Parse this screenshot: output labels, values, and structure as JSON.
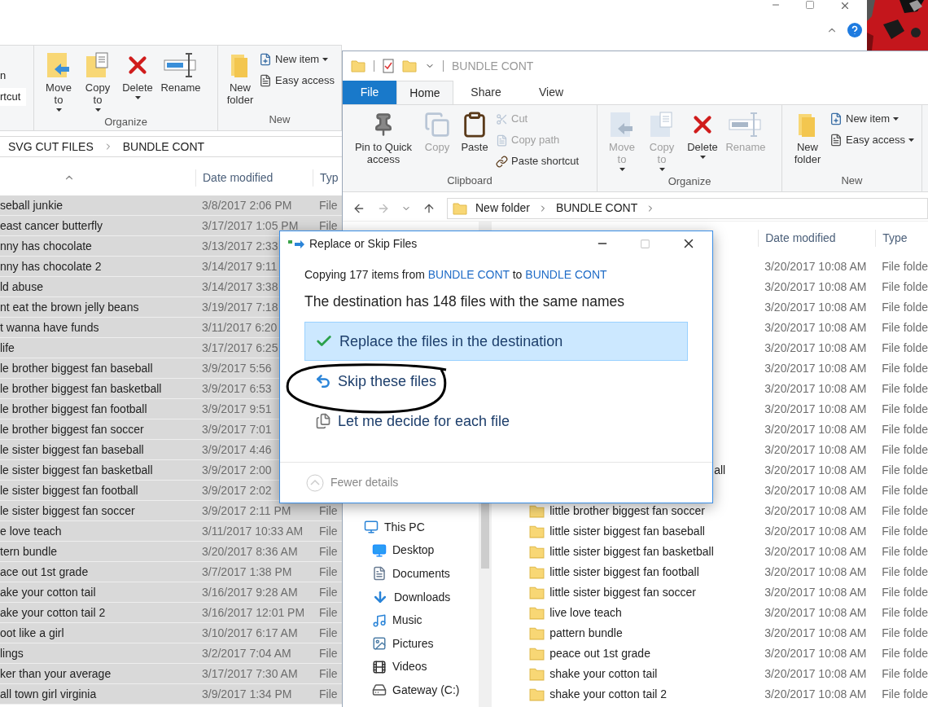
{
  "back_window": {
    "ribbon": {
      "fragment": [
        "n",
        "rtcut"
      ],
      "groups": [
        {
          "label": "Organize",
          "buttons": [
            {
              "kind": "move",
              "label": "Move\nto",
              "dropdown": true
            },
            {
              "kind": "copy",
              "label": "Copy\nto",
              "dropdown": true
            },
            {
              "kind": "delete",
              "label": "Delete",
              "dropdown": true
            },
            {
              "kind": "rename",
              "label": "Rename",
              "dropdown": false
            }
          ]
        },
        {
          "label": "New",
          "buttons": [
            {
              "kind": "folder",
              "label": "New\nfolder",
              "dropdown": false
            }
          ],
          "small": [
            {
              "kind": "newitem",
              "label": "New item",
              "dropdown": true
            },
            {
              "kind": "easy",
              "label": "Easy access"
            }
          ]
        }
      ]
    },
    "address": [
      "SVG CUT FILES",
      "BUNDLE CONT"
    ],
    "columns": [
      "Date modified",
      "Typ"
    ],
    "rows": [
      {
        "name": "seball junkie",
        "date": "3/8/2017 2:06 PM",
        "type": "File",
        "selected": true
      },
      {
        "name": "east cancer butterfly",
        "date": "3/17/2017 1:05 PM",
        "type": "File",
        "selected": true
      },
      {
        "name": "nny has chocolate",
        "date": "3/13/2017 2:33",
        "selected": true
      },
      {
        "name": "nny has chocolate 2",
        "date": "3/14/2017 9:11",
        "selected": true
      },
      {
        "name": "ld abuse",
        "date": "3/14/2017 3:38",
        "selected": true
      },
      {
        "name": "nt eat the brown jelly beans",
        "date": "3/19/2017 7:18",
        "selected": true
      },
      {
        "name": "t wanna have funds",
        "date": "3/11/2017 6:20",
        "selected": true
      },
      {
        "name": "life",
        "date": "3/17/2017 6:25",
        "selected": true
      },
      {
        "name": "le brother biggest fan baseball",
        "date": "3/9/2017 5:56",
        "selected": true
      },
      {
        "name": "le brother biggest fan basketball",
        "date": "3/9/2017 6:53",
        "selected": true
      },
      {
        "name": "le brother biggest fan football",
        "date": "3/9/2017 9:51",
        "selected": true
      },
      {
        "name": "le brother biggest fan soccer",
        "date": "3/9/2017 7:01",
        "selected": true
      },
      {
        "name": "le sister biggest fan baseball",
        "date": "3/9/2017 4:46",
        "selected": true
      },
      {
        "name": "le sister biggest fan basketball",
        "date": "3/9/2017 2:00",
        "selected": true
      },
      {
        "name": "le sister biggest fan football",
        "date": "3/9/2017 2:02",
        "selected": true
      },
      {
        "name": "le sister biggest fan soccer",
        "date": "3/9/2017 2:11 PM",
        "type": "File",
        "selected": true
      },
      {
        "name": "e love teach",
        "date": "3/11/2017 10:33 AM",
        "type": "File",
        "selected": true
      },
      {
        "name": "tern bundle",
        "date": "3/20/2017 8:36 AM",
        "type": "File",
        "selected": true
      },
      {
        "name": "ace out 1st grade",
        "date": "3/7/2017 1:38 PM",
        "type": "File",
        "selected": true
      },
      {
        "name": "ake your cotton tail",
        "date": "3/16/2017 9:28 AM",
        "type": "File",
        "selected": true
      },
      {
        "name": "ake your cotton tail 2",
        "date": "3/16/2017 12:01 PM",
        "type": "File",
        "selected": true
      },
      {
        "name": "oot like a girl",
        "date": "3/10/2017 6:17 AM",
        "type": "File",
        "selected": true
      },
      {
        "name": "lings",
        "date": "3/2/2017 7:04 AM",
        "type": "File",
        "selected": true
      },
      {
        "name": "ker than your average",
        "date": "3/17/2017 7:30 AM",
        "type": "File",
        "selected": true
      },
      {
        "name": "all town girl virginia",
        "date": "3/9/2017 1:34 PM",
        "type": "File",
        "selected": true
      }
    ]
  },
  "front_window": {
    "title": "BUNDLE CONT",
    "tabs": [
      {
        "label": "File",
        "kind": "file",
        "selected": false
      },
      {
        "label": "Home",
        "kind": "tab",
        "selected": true
      },
      {
        "label": "Share",
        "kind": "tab",
        "selected": false
      },
      {
        "label": "View",
        "kind": "tab",
        "selected": false
      }
    ],
    "ribbon": {
      "groups": [
        {
          "label": "Clipboard",
          "buttons": [
            {
              "kind": "pin",
              "label": "Pin to Quick\naccess",
              "dropdown": false,
              "disabled": false
            },
            {
              "kind": "copydoc",
              "label": "Copy",
              "dropdown": false,
              "disabled": true
            },
            {
              "kind": "paste",
              "label": "Paste",
              "dropdown": false,
              "disabled": false
            }
          ],
          "small": [
            {
              "kind": "cut",
              "label": "Cut",
              "dropdown": false,
              "disabled": true
            },
            {
              "kind": "copypath",
              "label": "Copy path",
              "dropdown": false,
              "disabled": true
            },
            {
              "kind": "shortcut",
              "label": "Paste shortcut",
              "dropdown": false,
              "disabled": false
            }
          ]
        },
        {
          "label": "Organize",
          "buttons": [
            {
              "kind": "move",
              "label": "Move\nto",
              "dropdown": true,
              "disabled": true
            },
            {
              "kind": "copy",
              "label": "Copy\nto",
              "dropdown": true,
              "disabled": true
            },
            {
              "kind": "delete",
              "label": "Delete",
              "dropdown": true,
              "disabled": false
            },
            {
              "kind": "rename",
              "label": "Rename",
              "dropdown": false,
              "disabled": true
            }
          ]
        },
        {
          "label": "New",
          "buttons": [
            {
              "kind": "folder",
              "label": "New\nfolder",
              "dropdown": false,
              "disabled": false
            }
          ],
          "small": [
            {
              "kind": "newitem",
              "label": "New item",
              "dropdown": true,
              "disabled": false
            },
            {
              "kind": "easy",
              "label": "Easy access",
              "dropdown": true,
              "disabled": false
            }
          ]
        }
      ]
    },
    "address": [
      "New folder",
      "BUNDLE CONT"
    ],
    "nav": [
      {
        "kind": "pc",
        "label": "This PC"
      },
      {
        "kind": "desktop",
        "label": "Desktop"
      },
      {
        "kind": "documents",
        "label": "Documents"
      },
      {
        "kind": "downloads",
        "label": "Downloads"
      },
      {
        "kind": "music",
        "label": "Music"
      },
      {
        "kind": "pictures",
        "label": "Pictures"
      },
      {
        "kind": "videos",
        "label": "Videos"
      },
      {
        "kind": "drive",
        "label": "Gateway (C:)"
      }
    ],
    "columns": [
      "Date modified",
      "Type"
    ],
    "rows": [
      {
        "date": "3/20/2017 10:08 AM",
        "type": "File folde",
        "selected": false
      },
      {
        "date": "3/20/2017 10:08 AM",
        "type": "File folde",
        "selected": false
      },
      {
        "date": "3/20/2017 10:08 AM",
        "type": "File folde",
        "selected": false
      },
      {
        "date": "3/20/2017 10:08 AM",
        "type": "File folde",
        "selected": false
      },
      {
        "date": "3/20/2017 10:08 AM",
        "type": "File folde",
        "selected": false
      },
      {
        "date": "3/20/2017 10:08 AM",
        "type": "File folde",
        "selected": false
      },
      {
        "date": "3/20/2017 10:08 AM",
        "type": "File folde",
        "selected": false
      },
      {
        "date": "3/20/2017 10:08 AM",
        "type": "File folde",
        "selected": false
      },
      {
        "date": "3/20/2017 10:08 AM",
        "type": "File folde",
        "selected": false
      },
      {
        "date": "3/20/2017 10:08 AM",
        "type": "File folde",
        "selected": false
      },
      {
        "name_tail": "all",
        "date": "3/20/2017 10:08 AM",
        "type": "File folde",
        "selected": false
      },
      {
        "date": "3/20/2017 10:08 AM",
        "type": "File folde",
        "selected": false
      },
      {
        "name": "little brother biggest fan soccer",
        "date": "3/20/2017 10:08 AM",
        "type": "File folde",
        "selected": false
      },
      {
        "name": "little sister biggest fan baseball",
        "date": "3/20/2017 10:08 AM",
        "type": "File folde",
        "selected": false
      },
      {
        "name": "little sister biggest fan basketball",
        "date": "3/20/2017 10:08 AM",
        "type": "File folde",
        "selected": false
      },
      {
        "name": "little sister biggest fan football",
        "date": "3/20/2017 10:08 AM",
        "type": "File folde",
        "selected": false
      },
      {
        "name": "little sister biggest fan soccer",
        "date": "3/20/2017 10:08 AM",
        "type": "File folde",
        "selected": false
      },
      {
        "name": "live love teach",
        "date": "3/20/2017 10:08 AM",
        "type": "File folde",
        "selected": false
      },
      {
        "name": "pattern bundle",
        "date": "3/20/2017 10:08 AM",
        "type": "File folde",
        "selected": false
      },
      {
        "name": "peace out 1st grade",
        "date": "3/20/2017 10:08 AM",
        "type": "File folde",
        "selected": false
      },
      {
        "name": "shake your cotton tail",
        "date": "3/20/2017 10:08 AM",
        "type": "File folde",
        "selected": false
      },
      {
        "name": "shake your cotton tail 2",
        "date": "3/20/2017 10:08 AM",
        "type": "File folde",
        "selected": false
      }
    ]
  },
  "dialog": {
    "title": "Replace or Skip Files",
    "summary": "Copying 177 items from ",
    "source": "BUNDLE CONT",
    "to": " to ",
    "target": "BUNDLE CONT",
    "message": "The destination has 148 files with the same names",
    "options": [
      {
        "kind": "replace",
        "label": "Replace the files in the destination",
        "highlighted": true
      },
      {
        "kind": "skip",
        "label": "Skip these files",
        "highlighted": false
      },
      {
        "kind": "decide",
        "label": "Let me decide for each file",
        "highlighted": false
      }
    ],
    "details": "Fewer details"
  }
}
